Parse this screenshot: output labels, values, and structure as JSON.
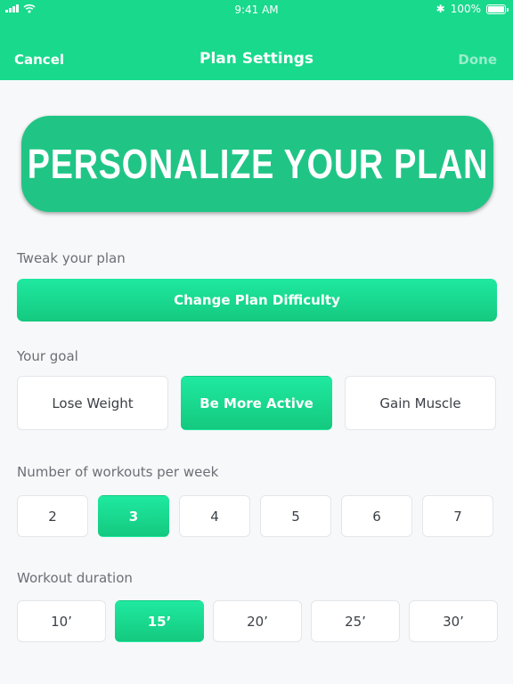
{
  "status_bar": {
    "time": "9:41 AM",
    "battery": "100%",
    "battery_level": 1.0,
    "bluetooth_symbol": "✱"
  },
  "nav": {
    "cancel": "Cancel",
    "title": "Plan Settings",
    "done": "Done"
  },
  "hero": {
    "text": "PERSONALIZE YOUR PLAN"
  },
  "tweak": {
    "label": "Tweak your plan",
    "button": "Change Plan Difficulty"
  },
  "goal": {
    "label": "Your goal",
    "options": [
      "Lose Weight",
      "Be More Active",
      "Gain Muscle"
    ],
    "selected": "Be More Active"
  },
  "workouts": {
    "label": "Number of workouts per week",
    "options": [
      "2",
      "3",
      "4",
      "5",
      "6",
      "7"
    ],
    "selected": "3"
  },
  "duration": {
    "label": "Workout duration",
    "options": [
      "10’",
      "15’",
      "20’",
      "25’",
      "30’"
    ],
    "selected": "15’"
  },
  "colors": {
    "accent": "#19d98c",
    "hero": "#20c586",
    "label": "#6b6f76"
  },
  "icons": [
    "signal-icon",
    "wifi-icon",
    "bluetooth-icon",
    "battery-icon"
  ]
}
